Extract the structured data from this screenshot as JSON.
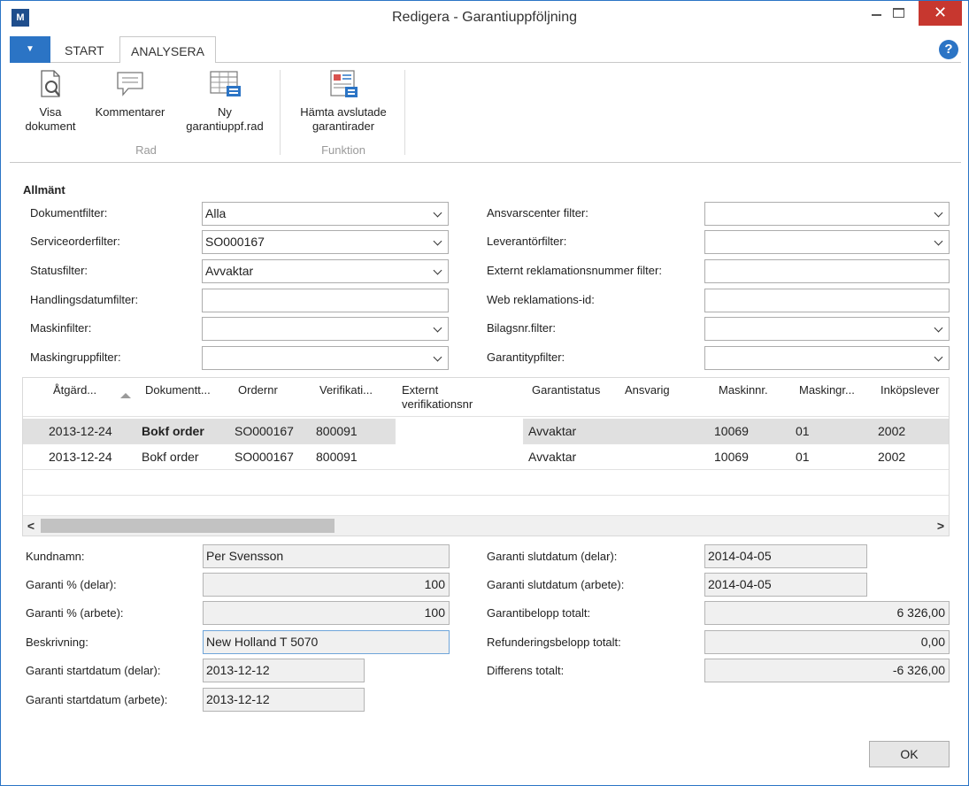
{
  "window": {
    "title": "Redigera - Garantiuppföljning",
    "min_glyph": "",
    "close_glyph": "✕"
  },
  "ribbon": {
    "app_menu_glyph": "▼",
    "tabs": [
      {
        "label": "START"
      },
      {
        "label": "ANALYSERA"
      }
    ],
    "help_glyph": "?",
    "groups": [
      {
        "label": "Rad",
        "buttons": [
          {
            "label_line1": "Visa",
            "label_line2": "dokument",
            "icon": "document-search-icon"
          },
          {
            "label_line1": "Kommentarer",
            "label_line2": "",
            "icon": "comment-icon"
          },
          {
            "label_line1": "Ny",
            "label_line2": "garantiuppf.rad",
            "icon": "new-line-icon"
          }
        ]
      },
      {
        "label": "Funktion",
        "buttons": [
          {
            "label_line1": "Hämta avslutade",
            "label_line2": "garantirader",
            "icon": "fetch-lines-icon"
          }
        ]
      }
    ]
  },
  "general": {
    "title": "Allmänt",
    "left": [
      {
        "label": "Dokumentfilter:",
        "value": "Alla",
        "dropdown": true
      },
      {
        "label": "Serviceorderfilter:",
        "value": "SO000167",
        "dropdown": true
      },
      {
        "label": "Statusfilter:",
        "value": "Avvaktar",
        "dropdown": true
      },
      {
        "label": "Handlingsdatumfilter:",
        "value": "",
        "dropdown": false
      },
      {
        "label": "Maskinfilter:",
        "value": "",
        "dropdown": true
      },
      {
        "label": "Maskingruppfilter:",
        "value": "",
        "dropdown": true
      }
    ],
    "right": [
      {
        "label": "Ansvarscenter filter:",
        "value": "",
        "dropdown": true
      },
      {
        "label": "Leverantörfilter:",
        "value": "",
        "dropdown": true
      },
      {
        "label": "Externt reklamationsnummer filter:",
        "value": "",
        "dropdown": false
      },
      {
        "label": "Web reklamations-id:",
        "value": "",
        "dropdown": false
      },
      {
        "label": "Bilagsnr.filter:",
        "value": "",
        "dropdown": true
      },
      {
        "label": "Garantitypfilter:",
        "value": "",
        "dropdown": true
      }
    ]
  },
  "grid": {
    "columns": [
      {
        "label": "Åtgärd...",
        "label2": ""
      },
      {
        "label": "Dokumentt...",
        "label2": ""
      },
      {
        "label": "Ordernr",
        "label2": ""
      },
      {
        "label": "Verifikati...",
        "label2": ""
      },
      {
        "label": "Externt",
        "label2": "verifikationsnr"
      },
      {
        "label": "Garantistatus",
        "label2": ""
      },
      {
        "label": "Ansvarig",
        "label2": ""
      },
      {
        "label": "Maskinnr.",
        "label2": ""
      },
      {
        "label": "Maskingr...",
        "label2": ""
      },
      {
        "label": "Inköpslever",
        "label2": ""
      }
    ],
    "rows": [
      {
        "date": "2013-12-24",
        "doctype": "Bokf order",
        "order": "SO000167",
        "verif": "800091",
        "ext": "",
        "status": "Avvaktar",
        "resp": "",
        "machine": "10069",
        "machgroup": "01",
        "vendor": "2002"
      },
      {
        "date": "2013-12-24",
        "doctype": "Bokf order",
        "order": "SO000167",
        "verif": "800091",
        "ext": "",
        "status": "Avvaktar",
        "resp": "",
        "machine": "10069",
        "machgroup": "01",
        "vendor": "2002"
      }
    ],
    "scroll_left": "<",
    "scroll_right": ">"
  },
  "details": {
    "left": [
      {
        "label": "Kundnamn:",
        "value": "Per Svensson"
      },
      {
        "label": "Garanti % (delar):",
        "value": "100"
      },
      {
        "label": "Garanti % (arbete):",
        "value": "100"
      },
      {
        "label": "Beskrivning:",
        "value": "New Holland T 5070"
      },
      {
        "label": "Garanti startdatum (delar):",
        "value": "2013-12-12"
      },
      {
        "label": "Garanti startdatum (arbete):",
        "value": "2013-12-12"
      }
    ],
    "right": [
      {
        "label": "Garanti slutdatum (delar):",
        "value": "2014-04-05"
      },
      {
        "label": "Garanti slutdatum (arbete):",
        "value": "2014-04-05"
      },
      {
        "label": "Garantibelopp totalt:",
        "value": "6 326,00"
      },
      {
        "label": "Refunderingsbelopp totalt:",
        "value": "0,00"
      },
      {
        "label": "Differens totalt:",
        "value": "-6 326,00"
      }
    ]
  },
  "footer": {
    "ok_label": "OK"
  }
}
